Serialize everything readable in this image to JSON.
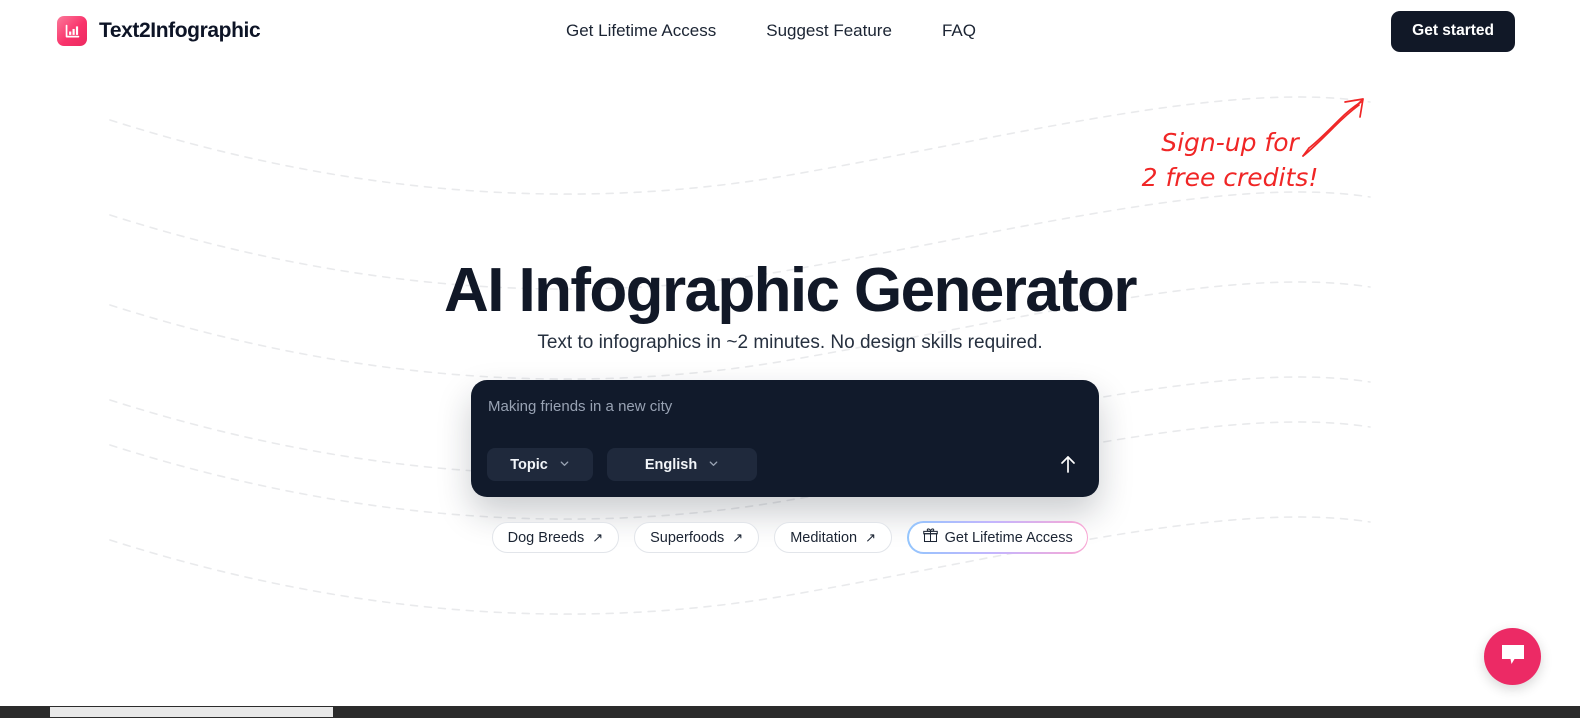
{
  "brand": {
    "name": "Text2Infographic",
    "icon": "bar-chart-icon",
    "accent_start": "#fb7a9a",
    "accent_end": "#ec2a60"
  },
  "header": {
    "nav": [
      {
        "label": "Get Lifetime Access"
      },
      {
        "label": "Suggest Feature"
      },
      {
        "label": "FAQ"
      }
    ],
    "cta_label": "Get started",
    "cta_bg": "#111827"
  },
  "annotation": {
    "line1": "Sign-up for",
    "line2": "2 free credits!",
    "color": "#f02626",
    "icon": "curved-arrow-up-right-icon"
  },
  "hero": {
    "title": "AI Infographic Generator",
    "subtitle": "Text to infographics in ~2 minutes. No design skills required."
  },
  "prompt": {
    "placeholder": "Making friends in a new city",
    "value": "",
    "card_bg": "#111a2b",
    "topic_label": "Topic",
    "language_label": "English",
    "submit_icon": "arrow-up-icon",
    "chevron_icon": "chevron-down-icon"
  },
  "chips": [
    {
      "label": "Dog Breeds",
      "icon": "arrow-up-right-icon",
      "gradient": false
    },
    {
      "label": "Superfoods",
      "icon": "arrow-up-right-icon",
      "gradient": false
    },
    {
      "label": "Meditation",
      "icon": "arrow-up-right-icon",
      "gradient": false
    },
    {
      "label": "Get Lifetime Access",
      "icon": "gift-icon",
      "gradient": true
    }
  ],
  "chat": {
    "icon": "chat-bubble-icon",
    "color": "#ec2a65"
  },
  "scrollbar": {
    "orientation": "horizontal",
    "thumb_color": "#e8e8e8",
    "track_color": "#2b2b2b"
  }
}
